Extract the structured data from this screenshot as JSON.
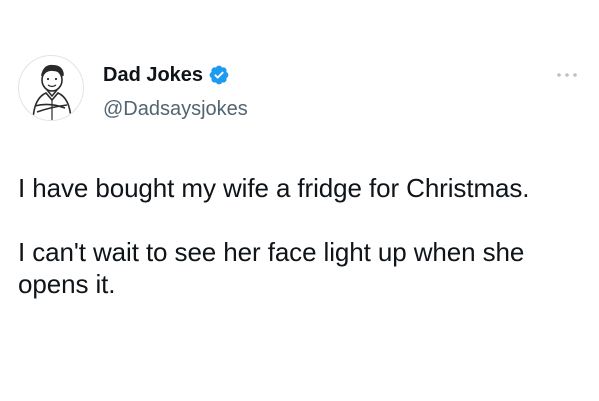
{
  "author": {
    "display_name": "Dad Jokes",
    "handle": "@Dadsaysjokes",
    "verified": true,
    "avatar_icon": "cartoon-man-avatar-icon",
    "verified_color": "#1d9bf0"
  },
  "more_icon": "ellipsis-icon",
  "tweet": {
    "paragraphs": [
      "I have bought my wife a fridge for Christmas.",
      "I can't wait to see her face light up when she opens it."
    ]
  },
  "colors": {
    "text": "#0f1419",
    "secondary_text": "#536471",
    "background": "#ffffff"
  }
}
